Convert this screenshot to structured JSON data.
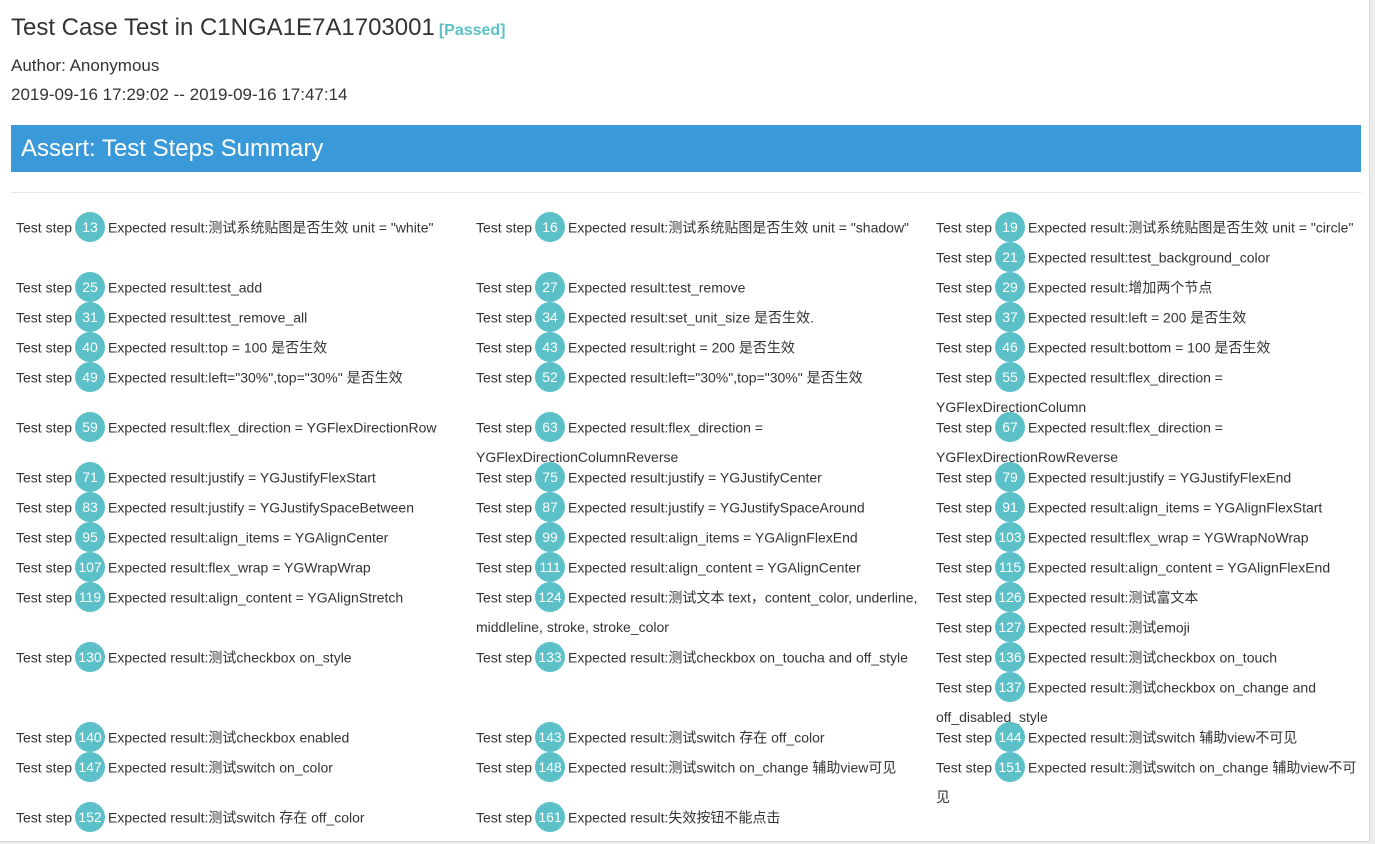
{
  "header": {
    "title": "Test Case Test in C1NGA1E7A1703001",
    "status": "[Passed]",
    "author": "Author: Anonymous",
    "time_range": "2019-09-16 17:29:02 -- 2019-09-16 17:47:14"
  },
  "section": {
    "title": "Assert: Test Steps Summary"
  },
  "labels": {
    "step_prefix": "Test step",
    "result_prefix": "Expected result:"
  },
  "steps": [
    {
      "num": "13",
      "result": "测试系统贴图是否生效 unit = \"white\""
    },
    {
      "num": "16",
      "result": "测试系统贴图是否生效 unit = \"shadow\""
    },
    {
      "num": "19",
      "result": "测试系统贴图是否生效 unit = \"circle\""
    },
    {
      "num": "21",
      "result": "test_background_color"
    },
    {
      "num": "25",
      "result": "test_add"
    },
    {
      "num": "27",
      "result": "test_remove"
    },
    {
      "num": "29",
      "result": "增加两个节点"
    },
    {
      "num": "31",
      "result": "test_remove_all"
    },
    {
      "num": "34",
      "result": "set_unit_size 是否生效."
    },
    {
      "num": "37",
      "result": "left = 200 是否生效"
    },
    {
      "num": "40",
      "result": "top = 100 是否生效"
    },
    {
      "num": "43",
      "result": "right = 200 是否生效"
    },
    {
      "num": "46",
      "result": "bottom = 100 是否生效"
    },
    {
      "num": "49",
      "result": "left=\"30%\",top=\"30%\" 是否生效"
    },
    {
      "num": "52",
      "result": "left=\"30%\",top=\"30%\" 是否生效"
    },
    {
      "num": "55",
      "result": "flex_direction = YGFlexDirectionColumn"
    },
    {
      "num": "59",
      "result": "flex_direction = YGFlexDirectionRow"
    },
    {
      "num": "63",
      "result": "flex_direction = YGFlexDirectionColumnReverse"
    },
    {
      "num": "67",
      "result": "flex_direction = YGFlexDirectionRowReverse"
    },
    {
      "num": "71",
      "result": "justify = YGJustifyFlexStart"
    },
    {
      "num": "75",
      "result": "justify = YGJustifyCenter"
    },
    {
      "num": "79",
      "result": "justify = YGJustifyFlexEnd"
    },
    {
      "num": "83",
      "result": "justify = YGJustifySpaceBetween"
    },
    {
      "num": "87",
      "result": "justify = YGJustifySpaceAround"
    },
    {
      "num": "91",
      "result": "align_items = YGAlignFlexStart"
    },
    {
      "num": "95",
      "result": "align_items = YGAlignCenter"
    },
    {
      "num": "99",
      "result": "align_items = YGAlignFlexEnd"
    },
    {
      "num": "103",
      "result": "flex_wrap = YGWrapNoWrap"
    },
    {
      "num": "107",
      "result": "flex_wrap = YGWrapWrap"
    },
    {
      "num": "111",
      "result": "align_content = YGAlignCenter"
    },
    {
      "num": "115",
      "result": "align_content = YGAlignFlexEnd"
    },
    {
      "num": "119",
      "result": "align_content = YGAlignStretch"
    },
    {
      "num": "124",
      "result": "测试文本 text，content_color, underline, middleline, stroke, stroke_color"
    },
    {
      "num": "126",
      "result": "测试富文本"
    },
    {
      "num": "127",
      "result": "测试emoji"
    },
    {
      "num": "130",
      "result": "测试checkbox on_style"
    },
    {
      "num": "133",
      "result": "测试checkbox on_toucha and off_style"
    },
    {
      "num": "136",
      "result": "测试checkbox on_touch"
    },
    {
      "num": "137",
      "result": "测试checkbox on_change and off_disabled_style"
    },
    {
      "num": "140",
      "result": "测试checkbox enabled"
    },
    {
      "num": "143",
      "result": "测试switch 存在 off_color"
    },
    {
      "num": "144",
      "result": "测试switch 辅助view不可见"
    },
    {
      "num": "147",
      "result": "测试switch on_color"
    },
    {
      "num": "148",
      "result": "测试switch on_change 辅助view可见"
    },
    {
      "num": "151",
      "result": "测试switch on_change 辅助view不可见"
    },
    {
      "num": "152",
      "result": "测试switch 存在 off_color"
    },
    {
      "num": "161",
      "result": "失效按钮不能点击"
    }
  ],
  "colors": {
    "banner": "#3a9ad9",
    "badge": "#5bc0c8",
    "status": "#5bc0c8"
  }
}
